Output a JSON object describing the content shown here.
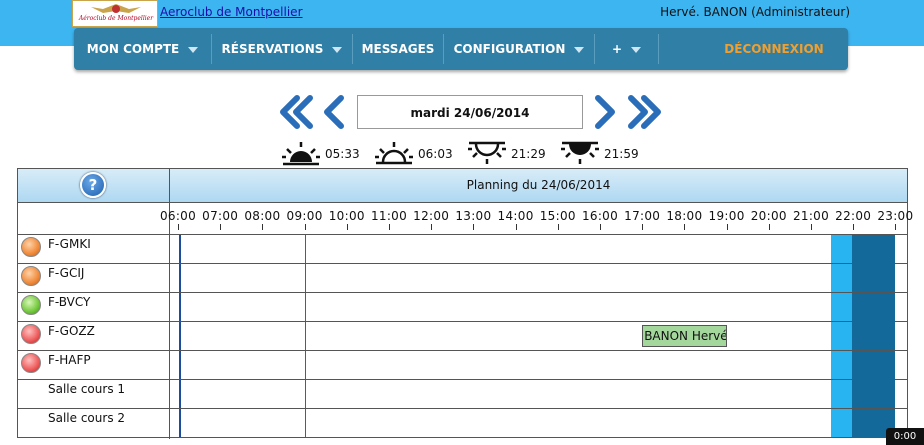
{
  "header": {
    "site_title": "Aeroclub de Montpellier",
    "logo_text": "Aéroclub de Montpellier",
    "user": "Hervé. BANON (Administrateur)"
  },
  "menu": {
    "items": [
      {
        "label": "MON COMPTE",
        "dropdown": true
      },
      {
        "label": "RÉSERVATIONS",
        "dropdown": true
      },
      {
        "label": "MESSAGES",
        "dropdown": false
      },
      {
        "label": "CONFIGURATION",
        "dropdown": true
      },
      {
        "label": "+",
        "dropdown": true
      }
    ],
    "logout": "DÉCONNEXION"
  },
  "date_nav": {
    "current_date": "mardi 24/06/2014",
    "icons": [
      "double-chevron-left-icon",
      "chevron-left-icon",
      "chevron-right-icon",
      "double-chevron-right-icon"
    ]
  },
  "sun_times": [
    {
      "icon": "dawn-icon",
      "time": "05:33"
    },
    {
      "icon": "sunrise-icon",
      "time": "06:03"
    },
    {
      "icon": "sunset-icon",
      "time": "21:29"
    },
    {
      "icon": "dusk-icon",
      "time": "21:59"
    }
  ],
  "planning": {
    "title": "Planning du 24/06/2014",
    "help": "?",
    "hours": [
      "06:00",
      "07:00",
      "08:00",
      "09:00",
      "10:00",
      "11:00",
      "12:00",
      "13:00",
      "14:00",
      "15:00",
      "16:00",
      "17:00",
      "18:00",
      "19:00",
      "20:00",
      "21:00",
      "22:00",
      "23:00"
    ],
    "resources": [
      {
        "name": "F-GMKI",
        "status": "orange",
        "bookings": []
      },
      {
        "name": "F-GCIJ",
        "status": "orange",
        "bookings": []
      },
      {
        "name": "F-BVCY",
        "status": "green",
        "bookings": []
      },
      {
        "name": "F-GOZZ",
        "status": "red",
        "bookings": [
          {
            "label": "BANON Hervé",
            "start": "17:00",
            "end": "19:00"
          }
        ]
      },
      {
        "name": "F-HAFP",
        "status": "red",
        "bookings": []
      },
      {
        "name": "Salle cours 1",
        "status": "",
        "bookings": []
      },
      {
        "name": "Salle cours 2",
        "status": "",
        "bookings": []
      }
    ]
  },
  "colors": {
    "topbar": "#3db5f0",
    "menubar": "#2f7fa6",
    "logout": "#f0a030",
    "booking": "#a4d79c",
    "dusk_light": "#27b4f0",
    "dusk_dark": "#13699a",
    "now_line": "#c03030"
  },
  "badge": "0:00"
}
